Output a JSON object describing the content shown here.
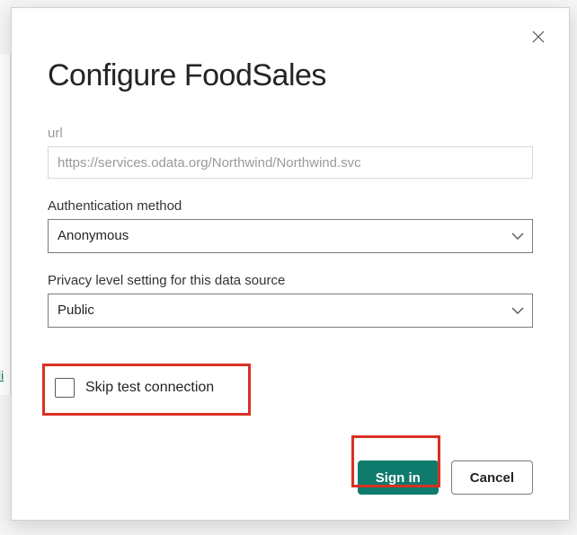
{
  "dialog": {
    "title": "Configure FoodSales",
    "close_label": "Close"
  },
  "fields": {
    "url": {
      "label": "url",
      "placeholder": "https://services.odata.org/Northwind/Northwind.svc",
      "value": ""
    },
    "auth": {
      "label": "Authentication method",
      "value": "Anonymous"
    },
    "privacy": {
      "label": "Privacy level setting for this data source",
      "value": "Public"
    },
    "skip_test": {
      "label": "Skip test connection",
      "checked": false
    }
  },
  "buttons": {
    "signin": "Sign in",
    "cancel": "Cancel"
  },
  "left_fragment": "li"
}
